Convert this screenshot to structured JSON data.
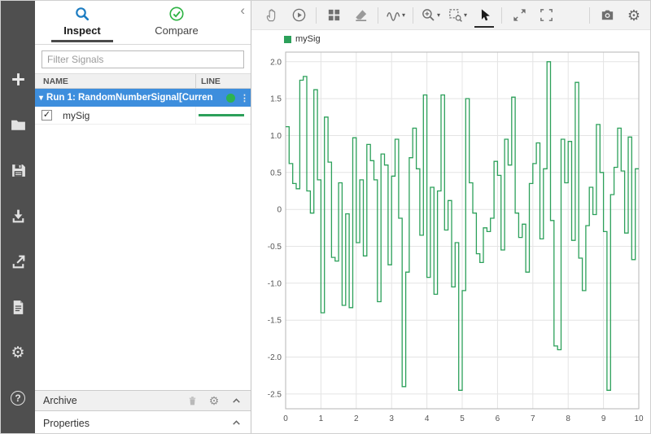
{
  "glyphs": {
    "gear": "⚙",
    "help": "?",
    "ellipsis": "⋮",
    "caret_down": "▾",
    "check": "✓",
    "chevron_left": "‹"
  },
  "colors": {
    "selection_blue": "#3d8edd",
    "accent_blue": "#1d7dc2",
    "signal_green": "#2ca05a",
    "status_green": "#2db351",
    "toolbar_dark": "#4f4f4f"
  },
  "left_toolbar": {
    "icons": [
      "add",
      "open-folder",
      "save",
      "import",
      "export",
      "create-report",
      "preferences",
      "help"
    ]
  },
  "left_panel": {
    "tabs": [
      {
        "label": "Inspect",
        "active": true
      },
      {
        "label": "Compare",
        "active": false
      }
    ],
    "filter_placeholder": "Filter Signals",
    "table": {
      "columns": [
        "NAME",
        "LINE"
      ],
      "rows": [
        {
          "type": "run",
          "label": "Run 1: RandomNumberSignal[Curren",
          "expanded": true,
          "status": "active"
        },
        {
          "type": "signal",
          "name": "mySig",
          "checked": true
        }
      ]
    },
    "archive": {
      "label": "Archive"
    },
    "properties": {
      "label": "Properties"
    }
  },
  "plot_toolbar": {
    "icons": [
      "pan-hand",
      "replay",
      "subplot-grid",
      "eraser",
      "signal-wave",
      "zoom-in",
      "zoom-region",
      "arrow-cursor",
      "expand-axes",
      "fit-to-view",
      "snapshot-camera",
      "plot-settings"
    ],
    "selected_tool": "arrow-cursor"
  },
  "chart_data": {
    "type": "line",
    "subtype": "stairstep",
    "title": "",
    "legend": [
      "mySig"
    ],
    "legend_position": "top-left",
    "grid": true,
    "xlim": [
      0,
      10
    ],
    "ylim": [
      -2.5,
      2
    ],
    "x_ticks": [
      0,
      1,
      2,
      3,
      4,
      5,
      6,
      7,
      8,
      9,
      10
    ],
    "y_ticks": [
      -2.5,
      -2,
      -1.5,
      -1,
      -0.5,
      0,
      0.5,
      1,
      1.5,
      2
    ],
    "series": [
      {
        "name": "mySig",
        "color": "#2ca05a",
        "x_start": 0,
        "x_step": 0.1,
        "values": [
          1.12,
          0.62,
          0.35,
          0.28,
          1.75,
          1.8,
          0.25,
          -0.05,
          1.62,
          0.4,
          -1.4,
          1.25,
          0.64,
          -0.65,
          -0.7,
          0.36,
          -1.3,
          -0.06,
          -1.33,
          0.97,
          -0.45,
          0.4,
          -0.63,
          0.88,
          0.66,
          0.4,
          -1.25,
          0.75,
          0.6,
          -0.75,
          0.45,
          0.95,
          -0.12,
          -2.4,
          -0.85,
          0.7,
          1.1,
          0.55,
          -0.35,
          1.55,
          -0.92,
          0.3,
          -1.15,
          0.25,
          1.55,
          -0.28,
          0.12,
          -1.05,
          -0.45,
          -2.45,
          -1.1,
          1.5,
          0.36,
          -0.05,
          -0.6,
          -0.72,
          -0.25,
          -0.3,
          -0.12,
          0.65,
          0.46,
          -0.55,
          0.95,
          0.6,
          1.52,
          -0.05,
          -0.38,
          -0.2,
          -0.85,
          0.35,
          0.62,
          0.9,
          -0.4,
          0.55,
          2.0,
          -0.15,
          -1.85,
          -1.9,
          0.95,
          0.36,
          0.92,
          -0.42,
          1.72,
          -0.66,
          -1.1,
          -0.22,
          0.3,
          -0.07,
          1.15,
          0.5,
          -0.3,
          -2.45,
          0.2,
          0.57,
          1.1,
          0.52,
          -0.32,
          0.98,
          -0.68,
          0.55
        ]
      }
    ]
  }
}
